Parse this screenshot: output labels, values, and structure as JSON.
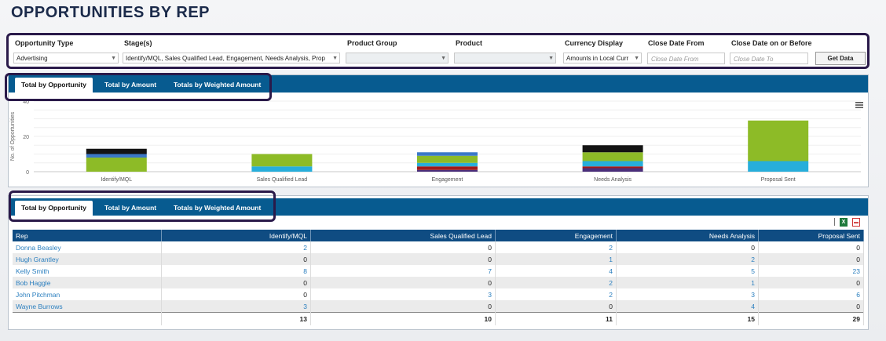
{
  "page": {
    "title": "OPPORTUNITIES BY REP"
  },
  "filters": {
    "opportunity_type": {
      "label": "Opportunity Type",
      "value": "Advertising"
    },
    "stages": {
      "label": "Stage(s)",
      "value": "Identify/MQL, Sales Qualified Lead, Engagement, Needs Analysis, Prop"
    },
    "product_group": {
      "label": "Product Group",
      "value": ""
    },
    "product": {
      "label": "Product",
      "value": ""
    },
    "currency": {
      "label": "Currency Display",
      "value": "Amounts in Local Curr"
    },
    "close_from": {
      "label": "Close Date From",
      "placeholder": "Close Date From"
    },
    "close_to": {
      "label": "Close Date on or Before",
      "placeholder": "Close Date To"
    },
    "get_data_label": "Get Data"
  },
  "tabs": {
    "items": [
      "Total by Opportunity",
      "Total by Amount",
      "Totals by Weighted Amount"
    ],
    "active": 0
  },
  "colors": {
    "tabbar": "#075b90",
    "outline": "#2a1a4a",
    "segments": {
      "Kelly Smith": "#8dbb27",
      "John Pitchman": "#27aedb",
      "Donna Beasley": "#3b78c7",
      "Hugh Grantley": "#4a2e7a",
      "Bob Haggle": "#a11b1b",
      "Wayne Burrows": "#141414"
    }
  },
  "chart_data": {
    "type": "bar",
    "stacked": true,
    "ylabel": "No. of Opportunities",
    "ylim": [
      0,
      40
    ],
    "yticks": [
      0,
      20,
      40
    ],
    "categories": [
      "Identify/MQL",
      "Sales Qualified Lead",
      "Engagement",
      "Needs Analysis",
      "Proposal Sent"
    ],
    "series": [
      {
        "name": "Hugh Grantley",
        "values": [
          0,
          0,
          1,
          2,
          0
        ]
      },
      {
        "name": "Bob Haggle",
        "values": [
          0,
          0,
          2,
          1,
          0
        ]
      },
      {
        "name": "John Pitchman",
        "values": [
          0,
          3,
          2,
          3,
          6
        ]
      },
      {
        "name": "Kelly Smith",
        "values": [
          8,
          7,
          4,
          5,
          23
        ]
      },
      {
        "name": "Donna Beasley",
        "values": [
          2,
          0,
          2,
          0,
          0
        ]
      },
      {
        "name": "Wayne Burrows",
        "values": [
          3,
          0,
          0,
          4,
          0
        ]
      }
    ],
    "grid": true
  },
  "table": {
    "columns": [
      "Rep",
      "Identify/MQL",
      "Sales Qualified Lead",
      "Engagement",
      "Needs Analysis",
      "Proposal Sent"
    ],
    "rows": [
      {
        "rep": "Donna Beasley",
        "cells": [
          "2",
          "0",
          "2",
          "0",
          "0"
        ]
      },
      {
        "rep": "Hugh Grantley",
        "cells": [
          "0",
          "0",
          "1",
          "2",
          "0"
        ]
      },
      {
        "rep": "Kelly Smith",
        "cells": [
          "8",
          "7",
          "4",
          "5",
          "23"
        ]
      },
      {
        "rep": "Bob Haggle",
        "cells": [
          "0",
          "0",
          "2",
          "1",
          "0"
        ]
      },
      {
        "rep": "John Pitchman",
        "cells": [
          "0",
          "3",
          "2",
          "3",
          "6"
        ]
      },
      {
        "rep": "Wayne Burrows",
        "cells": [
          "3",
          "0",
          "0",
          "4",
          "0"
        ]
      }
    ],
    "totals": [
      "13",
      "10",
      "11",
      "15",
      "29"
    ]
  }
}
